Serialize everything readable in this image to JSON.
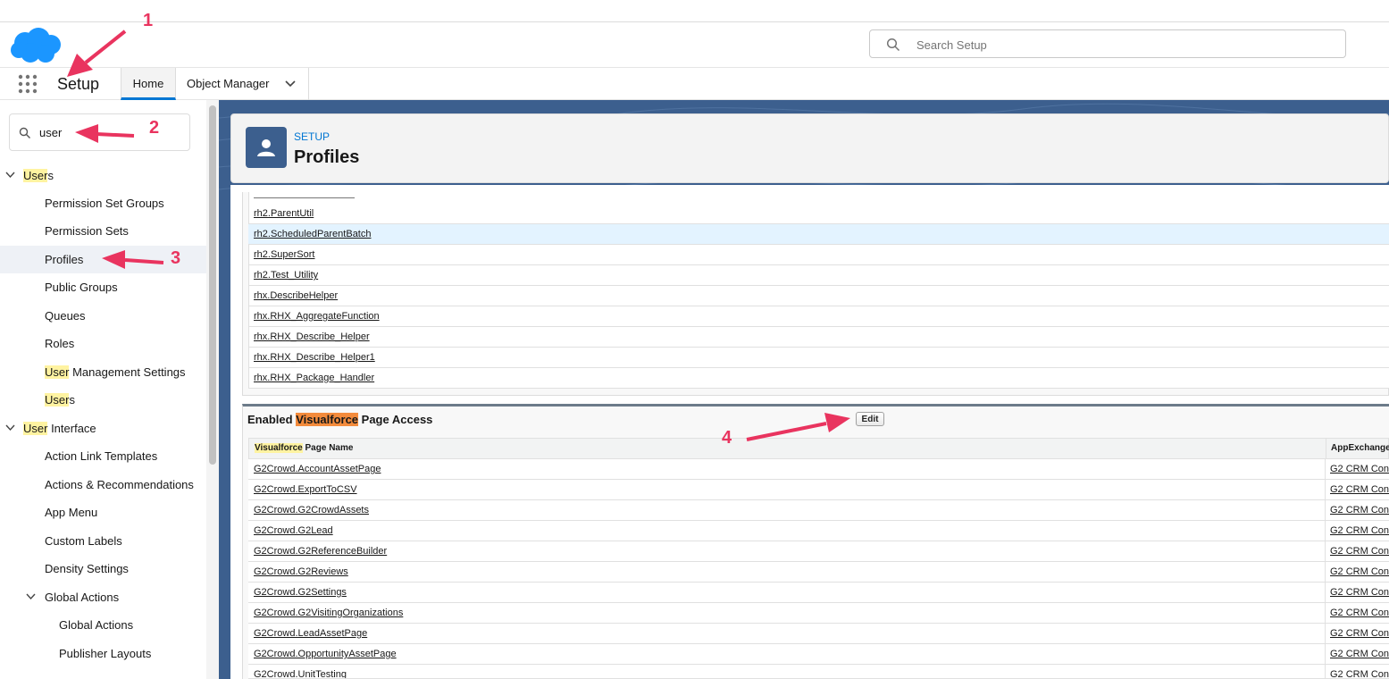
{
  "header": {
    "search_placeholder": "Search Setup",
    "app_name": "Setup",
    "tabs": [
      {
        "label": "Home"
      },
      {
        "label": "Object Manager"
      }
    ]
  },
  "sidebar": {
    "search_value": "user",
    "items": [
      {
        "label": "Users",
        "highlight": "User",
        "rest": "s"
      },
      {
        "label": "Permission Set Groups"
      },
      {
        "label": "Permission Sets"
      },
      {
        "label": "Profiles"
      },
      {
        "label": "Public Groups"
      },
      {
        "label": "Queues"
      },
      {
        "label": "Roles"
      },
      {
        "label": "User Management Settings",
        "highlight": "User",
        "rest": " Management Settings"
      },
      {
        "label": "Users",
        "highlight": "User",
        "rest": "s"
      },
      {
        "label": "User Interface",
        "highlight": "User",
        "rest": " Interface"
      },
      {
        "label": "Action Link Templates"
      },
      {
        "label": "Actions & Recommendations"
      },
      {
        "label": "App Menu"
      },
      {
        "label": "Custom Labels"
      },
      {
        "label": "Density Settings"
      },
      {
        "label": "Global Actions"
      },
      {
        "label": "Global Actions"
      },
      {
        "label": "Publisher Layouts"
      }
    ]
  },
  "page_header": {
    "supertitle": "SETUP",
    "title": "Profiles"
  },
  "apex_rows": [
    "rh2.ParentUtil",
    "rh2.ScheduledParentBatch",
    "rh2.SuperSort",
    "rh2.Test_Utility",
    "rhx.DescribeHelper",
    "rhx.RHX_AggregateFunction",
    "rhx.RHX_Describe_Helper",
    "rhx.RHX_Describe_Helper1",
    "rhx.RHX_Package_Handler"
  ],
  "vf_section": {
    "title_pre": "Enabled ",
    "title_highlight": "Visualforce",
    "title_post": " Page Access",
    "edit_label": "Edit",
    "col1_highlight": "Visualforce",
    "col1_rest": " Page Name",
    "col2": "AppExchange",
    "rows": [
      {
        "name": "G2Crowd.AccountAssetPage",
        "pkg": "G2 CRM Con"
      },
      {
        "name": "G2Crowd.ExportToCSV",
        "pkg": "G2 CRM Con"
      },
      {
        "name": "G2Crowd.G2CrowdAssets",
        "pkg": "G2 CRM Con"
      },
      {
        "name": "G2Crowd.G2Lead",
        "pkg": "G2 CRM Con"
      },
      {
        "name": "G2Crowd.G2ReferenceBuilder",
        "pkg": "G2 CRM Con"
      },
      {
        "name": "G2Crowd.G2Reviews",
        "pkg": "G2 CRM Con"
      },
      {
        "name": "G2Crowd.G2Settings",
        "pkg": "G2 CRM Con"
      },
      {
        "name": "G2Crowd.G2VisitingOrganizations",
        "pkg": "G2 CRM Con"
      },
      {
        "name": "G2Crowd.LeadAssetPage",
        "pkg": "G2 CRM Con"
      },
      {
        "name": "G2Crowd.OpportunityAssetPage",
        "pkg": "G2 CRM Con"
      },
      {
        "name": "G2Crowd.UnitTesting",
        "pkg": "G2 CRM Con"
      }
    ]
  },
  "annotations": [
    "1",
    "2",
    "3",
    "4"
  ],
  "colors": {
    "brand": "#1b96ff",
    "accent": "#0176d3",
    "header_bg": "#3c5f8e",
    "annotation": "#e9345f"
  }
}
